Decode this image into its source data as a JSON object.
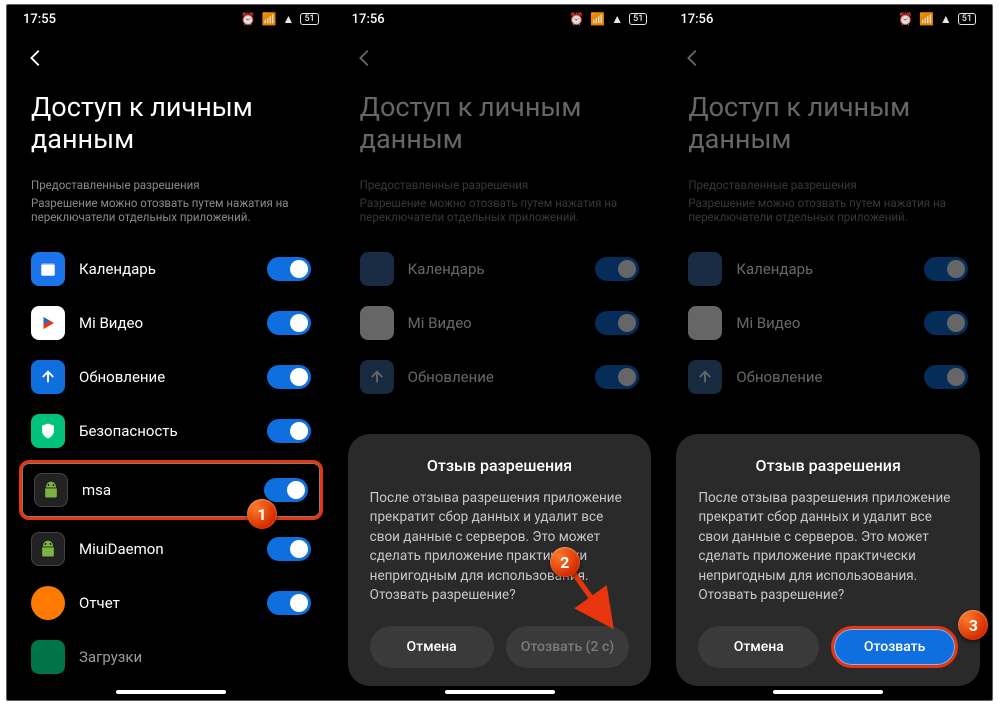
{
  "status": {
    "time1": "17:55",
    "time2": "17:56",
    "time3": "17:56",
    "battery": "51"
  },
  "page": {
    "title": "Доступ к личным данным",
    "subtitle": "Предоставленные разрешения",
    "hint": "Разрешение можно отозвать путем нажатия на переключатели отдельных приложений."
  },
  "apps": [
    {
      "label": "Календарь"
    },
    {
      "label": "Mi Видео"
    },
    {
      "label": "Обновление"
    },
    {
      "label": "Безопасность"
    },
    {
      "label": "msa"
    },
    {
      "label": "MiuiDaemon"
    },
    {
      "label": "Отчет"
    },
    {
      "label": "Загрузки"
    }
  ],
  "dialog": {
    "title": "Отзыв разрешения",
    "body": "После отзыва разрешения приложение прекратит сбор данных и удалит все свои данные с серверов. Это может сделать приложение практически непригодным для использования. Отозвать разрешение?",
    "cancel": "Отмена",
    "confirm_wait": "Отозвать (2 с)",
    "confirm": "Отозвать"
  },
  "badges": {
    "b1": "1",
    "b2": "2",
    "b3": "3"
  }
}
